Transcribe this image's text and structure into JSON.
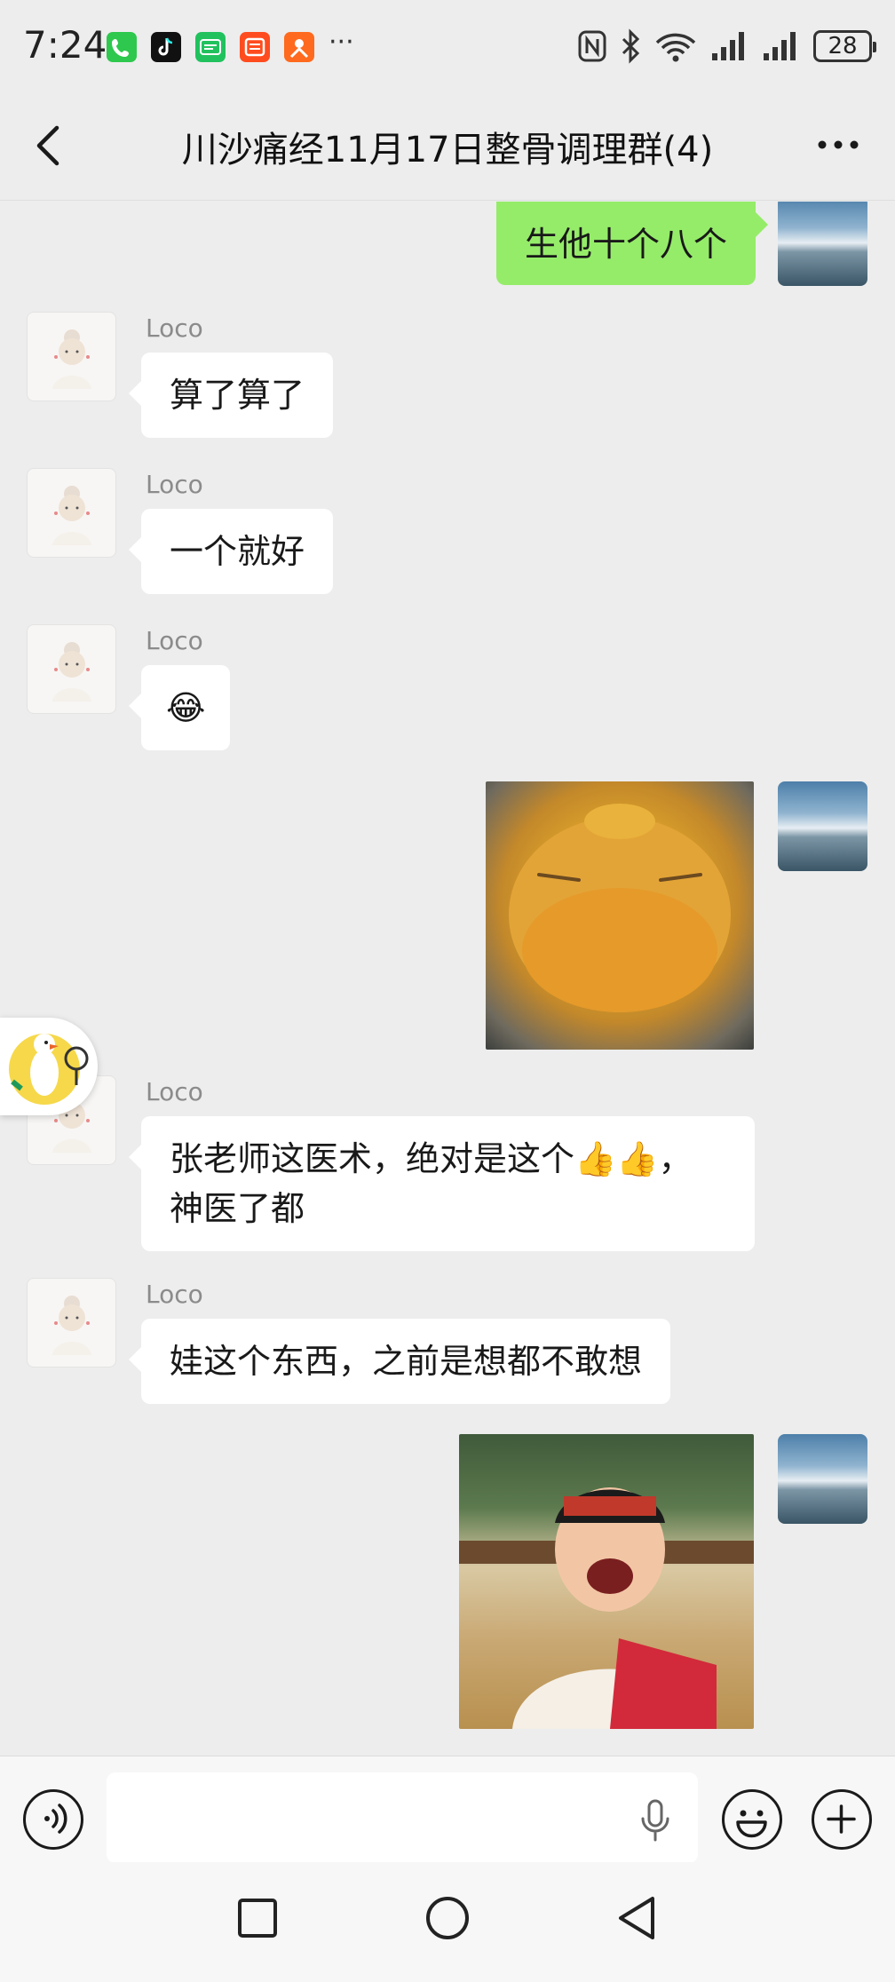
{
  "status_bar": {
    "time": "7:24",
    "battery": "28",
    "app_icons": [
      "phone-app-icon",
      "tiktok-app-icon",
      "iqiyi-app-icon",
      "taobao-app-icon",
      "meituan-app-icon"
    ],
    "overflow": "···"
  },
  "header": {
    "title": "川沙痛经11月17日整骨调理群(4)"
  },
  "messages": [
    {
      "side": "out",
      "type": "text",
      "text": "生他十个八个"
    },
    {
      "side": "in",
      "sender": "Loco",
      "type": "text",
      "text": "算了算了"
    },
    {
      "side": "in",
      "sender": "Loco",
      "type": "text",
      "text": "一个就好"
    },
    {
      "side": "in",
      "sender": "Loco",
      "type": "emoji",
      "text": "😂"
    },
    {
      "side": "out",
      "type": "sticker",
      "sticker": "yellow-creature-sticker"
    },
    {
      "side": "in",
      "sender": "Loco",
      "type": "text",
      "text_line1": "张老师这医术，绝对是这个👍👍，",
      "text_line2": "神医了都"
    },
    {
      "side": "in",
      "sender": "Loco",
      "type": "text",
      "text": "娃这个东西，之前是想都不敢想"
    },
    {
      "side": "out",
      "type": "sticker",
      "sticker": "laughing-child-photo"
    }
  ],
  "input": {
    "placeholder": ""
  },
  "colors": {
    "background": "#ededed",
    "bubble_out": "#95ec69",
    "bubble_in": "#ffffff",
    "sender_name": "#8b8b8b"
  }
}
